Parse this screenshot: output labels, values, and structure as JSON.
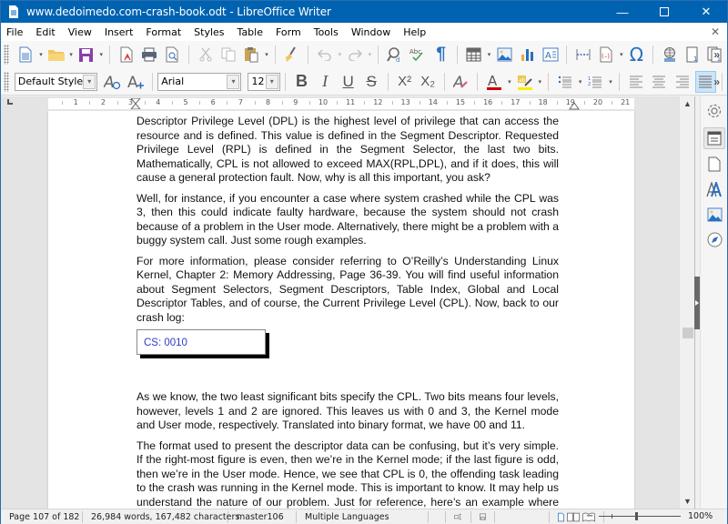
{
  "window": {
    "title": "www.dedoimedo.com-crash-book.odt - LibreOffice Writer",
    "minimize_glyph": "—",
    "maximize_glyph": "☐",
    "close_glyph": "✕",
    "accent_color": "#0063b1"
  },
  "menubar": {
    "items": [
      "File",
      "Edit",
      "View",
      "Insert",
      "Format",
      "Styles",
      "Table",
      "Form",
      "Tools",
      "Window",
      "Help"
    ],
    "close_document_glyph": "✕"
  },
  "toolbar_standard": {
    "icons": [
      "new-document-icon",
      "open-folder-icon",
      "save-icon",
      "export-pdf-icon",
      "print-icon",
      "print-preview-icon",
      "cut-icon",
      "copy-icon",
      "paste-icon",
      "clone-formatting-icon",
      "undo-icon",
      "redo-icon",
      "find-replace-icon",
      "spelling-icon",
      "formatting-marks-icon",
      "insert-table-icon",
      "insert-image-icon",
      "insert-chart-icon",
      "insert-textbox-icon",
      "insert-page-break-icon",
      "insert-field-icon",
      "special-character-icon",
      "hyperlink-icon",
      "footnote-icon",
      "endnote-icon"
    ],
    "special_char_glyph": "Ω",
    "formatting_marks_glyph": "¶",
    "more_glyph": "»"
  },
  "toolbar_formatting": {
    "paragraph_style": "Default Style",
    "font_name": "Arial",
    "font_size": "12",
    "bold_glyph": "B",
    "italic_glyph": "I",
    "underline_glyph": "U",
    "strikethrough_glyph": "S",
    "superscript_label": "X²",
    "subscript_label": "X₂",
    "font_color": "#cc0000",
    "highlight_color": "#ffee00",
    "active_alignment": "justified",
    "more_glyph": "»"
  },
  "ruler": {
    "numbers": [
      "1",
      "2",
      "3",
      "4",
      "5",
      "6",
      "7",
      "8",
      "9",
      "10",
      "11",
      "12",
      "13",
      "14",
      "15",
      "16",
      "17",
      "18",
      "19",
      "20",
      "21"
    ]
  },
  "document": {
    "paragraphs_top": [
      "Descriptor Privilege Level (DPL) is the highest level of privilege that can access the resource and is defined.  This value is defined in the Segment Descriptor.  Requested Privilege Level (RPL) is defined in the Segment Selector, the last two bits.  Mathematically, CPL is not allowed to exceed MAX(RPL,DPL), and if it does, this will cause a general protection fault. Now, why is all this important, you ask?",
      "Well, for instance, if you encounter a case where system crashed while the CPL was 3, then this could indicate faulty hardware, because the system should not crash because of a problem in the User mode.  Alternatively, there might be a problem with a buggy system call. Just some rough examples.",
      "For more information, please consider referring to O’Reilly’s Understanding Linux Kernel, Chapter 2: Memory Addressing, Page 36-39. You will find useful information about Segment Selectors, Segment Descriptors, Table Index, Global and Local Descriptor Tables, and of course, the Current Privilege Level (CPL). Now, back to our crash log:"
    ],
    "code_box": "CS: 0010",
    "paragraphs_bottom": [
      "As we know, the two least significant bits specify the CPL. Two bits means four levels, however, levels 1 and 2 are ignored.  This leaves us with 0 and 3, the Kernel mode and User mode, respectively. Translated into binary format, we have 00 and 11.",
      "The format used to present the descriptor data can be confusing, but it’s very simple. If the right-most figure is even, then we’re in the Kernel mode; if the last figure is odd, then we’re in the User mode. Hence, we see that CPL is 0, the offending task leading to  the crash was running in the Kernel mode.  This is important to know.  It may help us understand the nature of our problem.  Just for reference, here’s an example where the"
    ]
  },
  "sidebar": {
    "items": [
      "properties-icon",
      "page-icon",
      "styles-icon",
      "gallery-icon",
      "navigator-icon"
    ],
    "active": "properties-icon"
  },
  "statusbar": {
    "page": "Page 107 of 182",
    "word_count": "26,984 words, 167,482 characters",
    "page_style": "master106",
    "language": "Multiple Languages",
    "zoom_percent": "100%",
    "zoom_value": 100
  }
}
